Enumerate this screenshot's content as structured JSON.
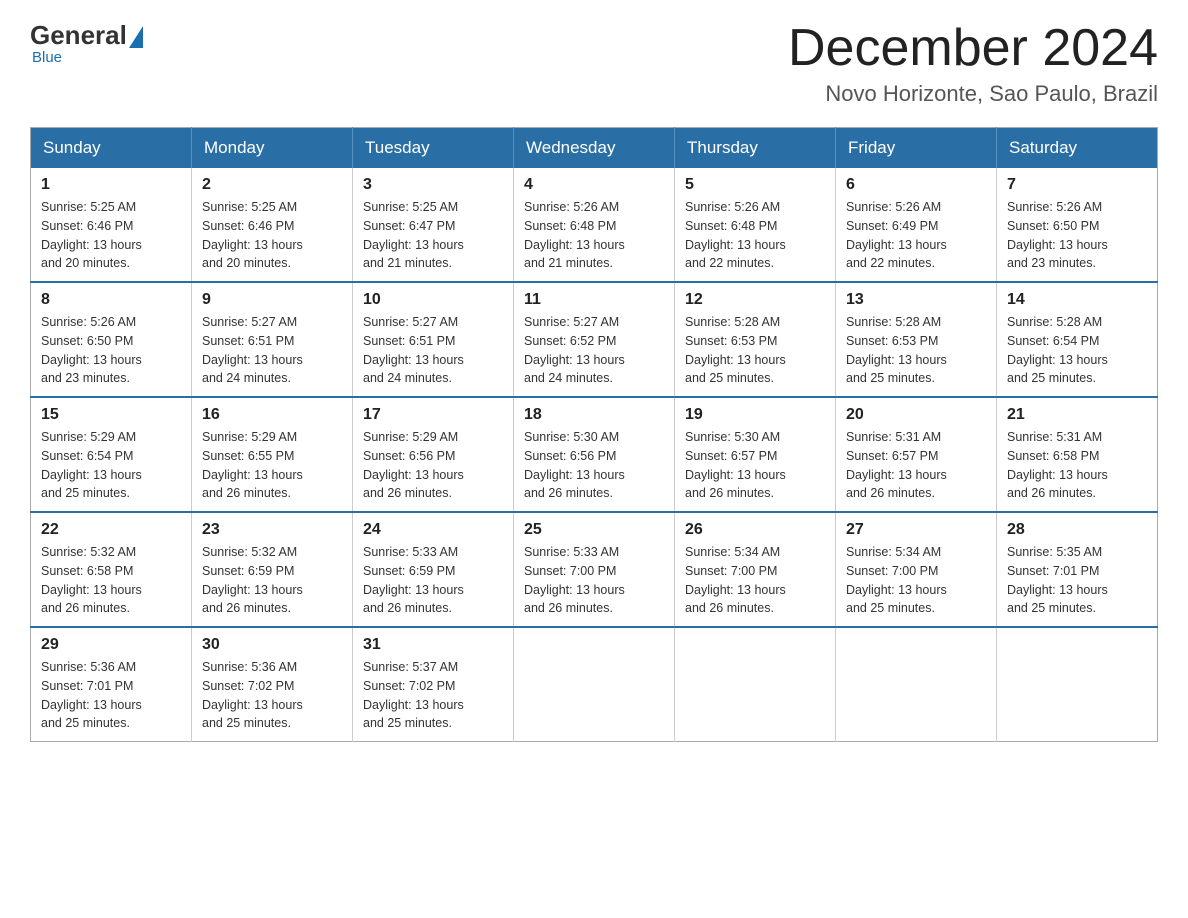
{
  "logo": {
    "general": "General",
    "blue_text": "Blue",
    "tagline": "Blue"
  },
  "header": {
    "month_year": "December 2024",
    "location": "Novo Horizonte, Sao Paulo, Brazil"
  },
  "days_of_week": [
    "Sunday",
    "Monday",
    "Tuesday",
    "Wednesday",
    "Thursday",
    "Friday",
    "Saturday"
  ],
  "weeks": [
    [
      {
        "day": "1",
        "sunrise": "5:25 AM",
        "sunset": "6:46 PM",
        "daylight": "13 hours and 20 minutes."
      },
      {
        "day": "2",
        "sunrise": "5:25 AM",
        "sunset": "6:46 PM",
        "daylight": "13 hours and 20 minutes."
      },
      {
        "day": "3",
        "sunrise": "5:25 AM",
        "sunset": "6:47 PM",
        "daylight": "13 hours and 21 minutes."
      },
      {
        "day": "4",
        "sunrise": "5:26 AM",
        "sunset": "6:48 PM",
        "daylight": "13 hours and 21 minutes."
      },
      {
        "day": "5",
        "sunrise": "5:26 AM",
        "sunset": "6:48 PM",
        "daylight": "13 hours and 22 minutes."
      },
      {
        "day": "6",
        "sunrise": "5:26 AM",
        "sunset": "6:49 PM",
        "daylight": "13 hours and 22 minutes."
      },
      {
        "day": "7",
        "sunrise": "5:26 AM",
        "sunset": "6:50 PM",
        "daylight": "13 hours and 23 minutes."
      }
    ],
    [
      {
        "day": "8",
        "sunrise": "5:26 AM",
        "sunset": "6:50 PM",
        "daylight": "13 hours and 23 minutes."
      },
      {
        "day": "9",
        "sunrise": "5:27 AM",
        "sunset": "6:51 PM",
        "daylight": "13 hours and 24 minutes."
      },
      {
        "day": "10",
        "sunrise": "5:27 AM",
        "sunset": "6:51 PM",
        "daylight": "13 hours and 24 minutes."
      },
      {
        "day": "11",
        "sunrise": "5:27 AM",
        "sunset": "6:52 PM",
        "daylight": "13 hours and 24 minutes."
      },
      {
        "day": "12",
        "sunrise": "5:28 AM",
        "sunset": "6:53 PM",
        "daylight": "13 hours and 25 minutes."
      },
      {
        "day": "13",
        "sunrise": "5:28 AM",
        "sunset": "6:53 PM",
        "daylight": "13 hours and 25 minutes."
      },
      {
        "day": "14",
        "sunrise": "5:28 AM",
        "sunset": "6:54 PM",
        "daylight": "13 hours and 25 minutes."
      }
    ],
    [
      {
        "day": "15",
        "sunrise": "5:29 AM",
        "sunset": "6:54 PM",
        "daylight": "13 hours and 25 minutes."
      },
      {
        "day": "16",
        "sunrise": "5:29 AM",
        "sunset": "6:55 PM",
        "daylight": "13 hours and 26 minutes."
      },
      {
        "day": "17",
        "sunrise": "5:29 AM",
        "sunset": "6:56 PM",
        "daylight": "13 hours and 26 minutes."
      },
      {
        "day": "18",
        "sunrise": "5:30 AM",
        "sunset": "6:56 PM",
        "daylight": "13 hours and 26 minutes."
      },
      {
        "day": "19",
        "sunrise": "5:30 AM",
        "sunset": "6:57 PM",
        "daylight": "13 hours and 26 minutes."
      },
      {
        "day": "20",
        "sunrise": "5:31 AM",
        "sunset": "6:57 PM",
        "daylight": "13 hours and 26 minutes."
      },
      {
        "day": "21",
        "sunrise": "5:31 AM",
        "sunset": "6:58 PM",
        "daylight": "13 hours and 26 minutes."
      }
    ],
    [
      {
        "day": "22",
        "sunrise": "5:32 AM",
        "sunset": "6:58 PM",
        "daylight": "13 hours and 26 minutes."
      },
      {
        "day": "23",
        "sunrise": "5:32 AM",
        "sunset": "6:59 PM",
        "daylight": "13 hours and 26 minutes."
      },
      {
        "day": "24",
        "sunrise": "5:33 AM",
        "sunset": "6:59 PM",
        "daylight": "13 hours and 26 minutes."
      },
      {
        "day": "25",
        "sunrise": "5:33 AM",
        "sunset": "7:00 PM",
        "daylight": "13 hours and 26 minutes."
      },
      {
        "day": "26",
        "sunrise": "5:34 AM",
        "sunset": "7:00 PM",
        "daylight": "13 hours and 26 minutes."
      },
      {
        "day": "27",
        "sunrise": "5:34 AM",
        "sunset": "7:00 PM",
        "daylight": "13 hours and 25 minutes."
      },
      {
        "day": "28",
        "sunrise": "5:35 AM",
        "sunset": "7:01 PM",
        "daylight": "13 hours and 25 minutes."
      }
    ],
    [
      {
        "day": "29",
        "sunrise": "5:36 AM",
        "sunset": "7:01 PM",
        "daylight": "13 hours and 25 minutes."
      },
      {
        "day": "30",
        "sunrise": "5:36 AM",
        "sunset": "7:02 PM",
        "daylight": "13 hours and 25 minutes."
      },
      {
        "day": "31",
        "sunrise": "5:37 AM",
        "sunset": "7:02 PM",
        "daylight": "13 hours and 25 minutes."
      },
      null,
      null,
      null,
      null
    ]
  ],
  "labels": {
    "sunrise_prefix": "Sunrise: ",
    "sunset_prefix": "Sunset: ",
    "daylight_prefix": "Daylight: "
  }
}
